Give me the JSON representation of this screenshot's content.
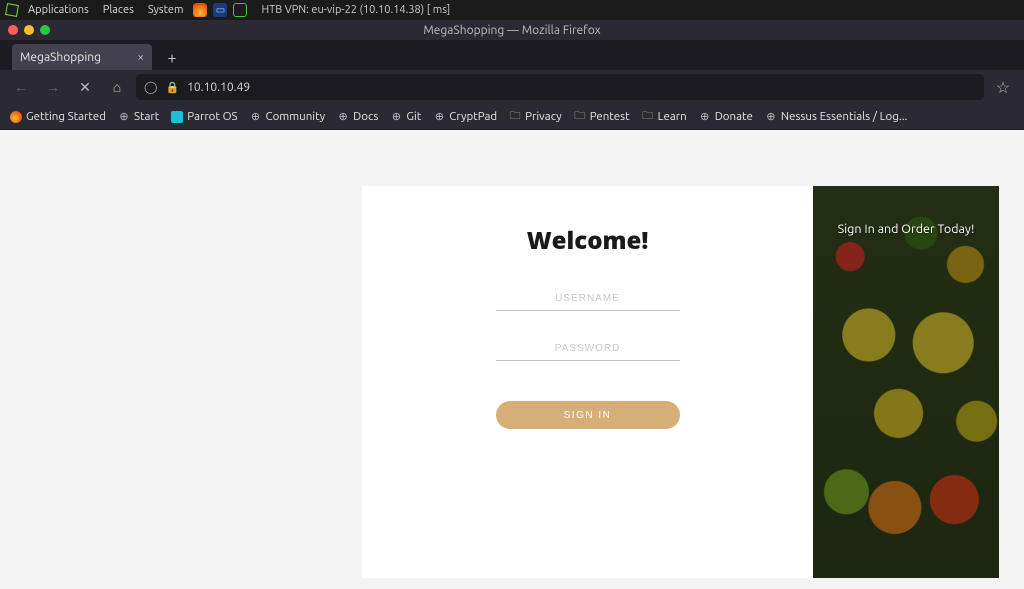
{
  "os_panel": {
    "menus": [
      "Applications",
      "Places",
      "System"
    ],
    "vpn_status": "HTB VPN: eu-vip-22 (10.10.14.38) [ ms]"
  },
  "window": {
    "title": "MegaShopping — Mozilla Firefox"
  },
  "tab": {
    "label": "MegaShopping"
  },
  "address": {
    "url": "10.10.10.49"
  },
  "bookmarks": {
    "getting_started": "Getting Started",
    "start": "Start",
    "parrot_os": "Parrot OS",
    "community": "Community",
    "docs": "Docs",
    "git": "Git",
    "cryptpad": "CryptPad",
    "privacy": "Privacy",
    "pentest": "Pentest",
    "learn": "Learn",
    "donate": "Donate",
    "nessus": "Nessus Essentials / Log..."
  },
  "page": {
    "heading": "Welcome!",
    "username_placeholder": "USERNAME",
    "password_placeholder": "PASSWORD",
    "signin_label": "SIGN IN",
    "right_text": "Sign In and Order Today!"
  }
}
